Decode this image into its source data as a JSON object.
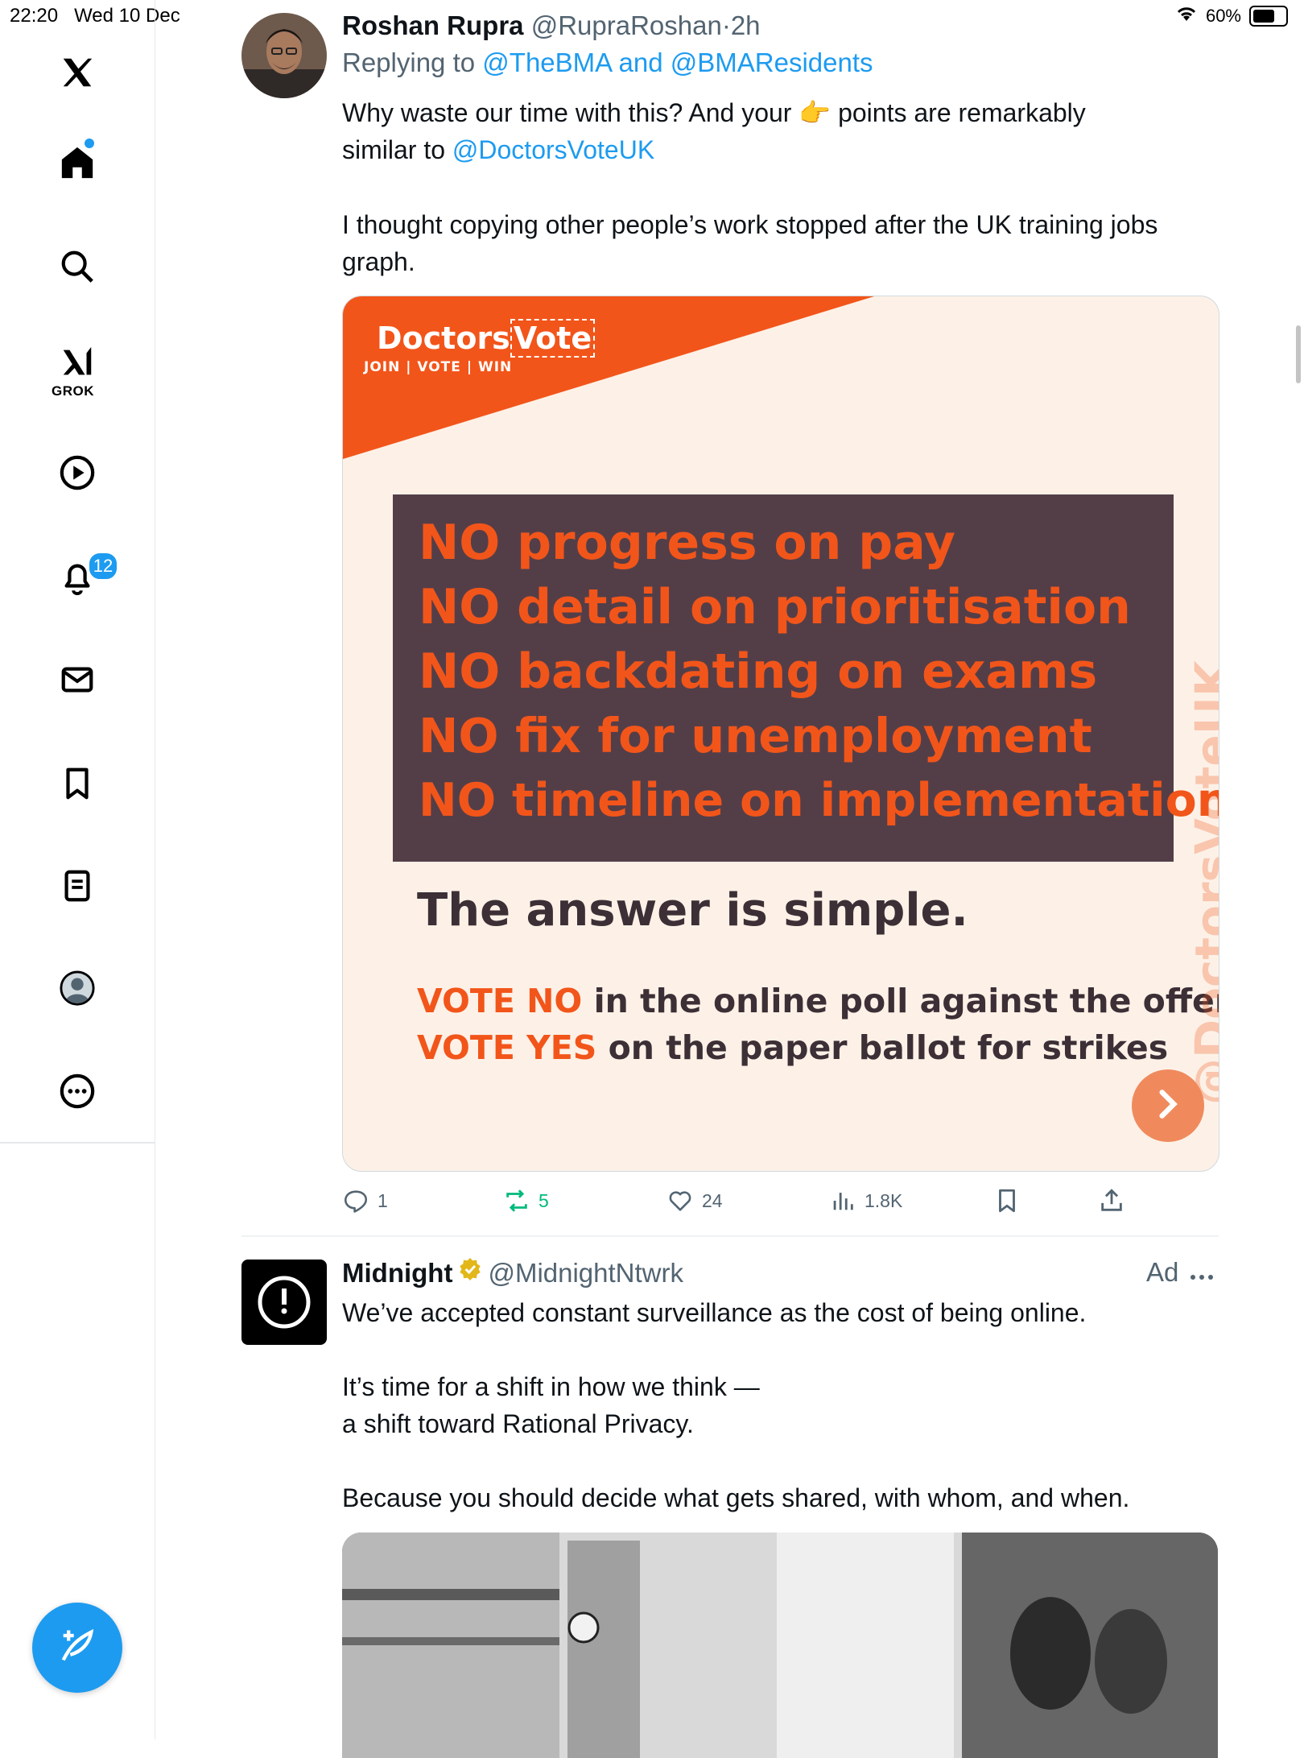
{
  "status": {
    "time": "22:20",
    "date": "Wed 10 Dec",
    "battery": "60%",
    "battery_level": 0.6
  },
  "nav": {
    "grok_label": "GROK",
    "notif_count": "12"
  },
  "tweet": {
    "name": "Roshan Rupra",
    "handle": "@RupraRoshan",
    "sep": "·",
    "time": "2h",
    "replying_prefix": "Replying to",
    "reply_1": "@TheBMA",
    "reply_and": "and",
    "reply_2": "@BMAResidents",
    "text_a": "Why waste our time with this? And your",
    "emoji": "👉",
    "text_b": "points are remarkably",
    "text_c": "similar to",
    "mention": "@DoctorsVoteUK",
    "text_d": "I thought copying other people’s work stopped after the UK training jobs graph.",
    "stats": {
      "replies": "1",
      "reposts": "5",
      "likes": "24",
      "views": "1.8K"
    }
  },
  "poster": {
    "logo_a": "Doctors",
    "logo_b": "Vote",
    "tagline": "JOIN | VOTE | WIN",
    "lines": [
      "NO progress on pay",
      "NO detail on prioritisation",
      "NO backdating on exams",
      "NO fix for unemployment",
      "NO timeline on implementation"
    ],
    "answer": "The answer is simple.",
    "vote1_a": "VOTE NO",
    "vote1_b": "in the online poll against the offer",
    "vote2_a": "VOTE YES",
    "vote2_b": "on the paper ballot for strikes",
    "watermark": "@DoctorsVoteUK",
    "colors": {
      "orange": "#f2551a",
      "panel": "#533e48",
      "cream": "#fdf1e7"
    }
  },
  "ad": {
    "name": "Midnight",
    "handle": "@MidnightNtwrk",
    "label": "Ad",
    "line1": "We’ve accepted constant surveillance as the cost of being online.",
    "line2": "It’s time for a shift in how we think —",
    "line3": "a shift toward Rational Privacy.",
    "line4": "Because you should decide what gets shared, with whom, and when."
  },
  "icons": [
    "x-logo-icon",
    "home-icon",
    "search-icon",
    "grok-icon",
    "play-icon",
    "bell-icon",
    "mail-icon",
    "bookmark-icon",
    "lists-icon",
    "profile-icon",
    "more-icon",
    "compose-icon",
    "reply-icon",
    "repost-icon",
    "like-icon",
    "views-icon",
    "share-icon",
    "verified-icon",
    "wifi-icon",
    "battery-icon"
  ]
}
